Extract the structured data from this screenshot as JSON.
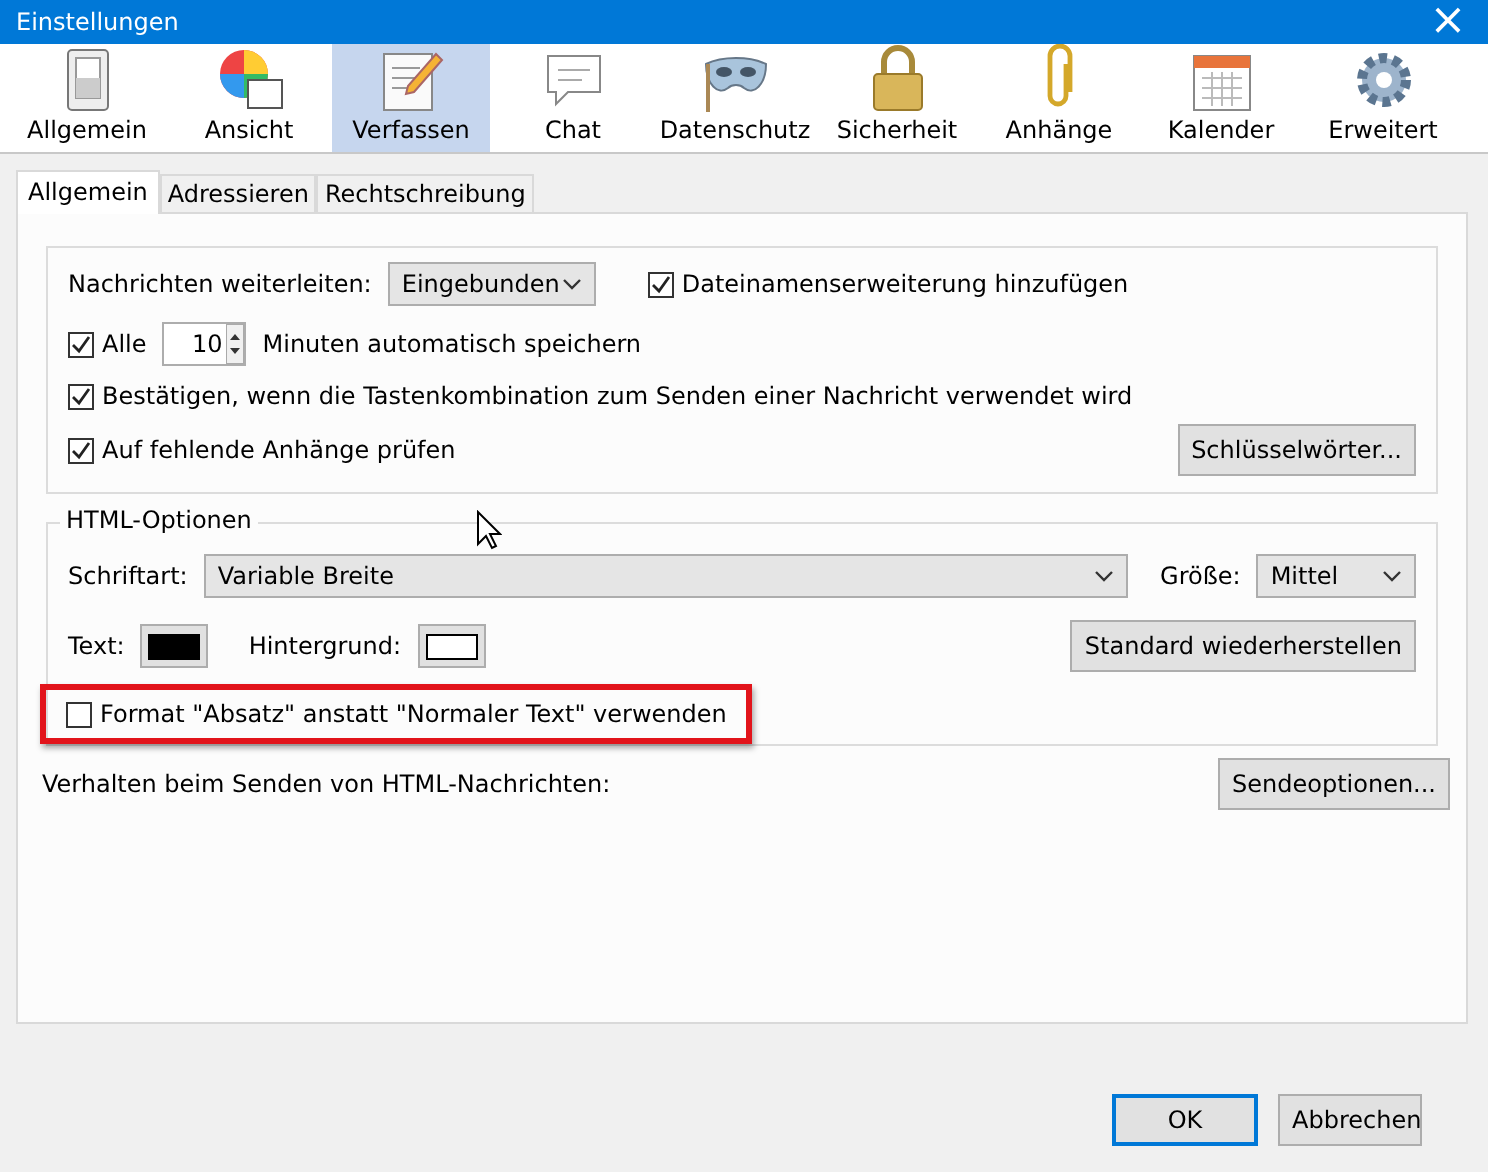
{
  "window": {
    "title": "Einstellungen",
    "close": "×"
  },
  "panes": [
    {
      "label": "Allgemein",
      "selected": false
    },
    {
      "label": "Ansicht",
      "selected": false
    },
    {
      "label": "Verfassen",
      "selected": true
    },
    {
      "label": "Chat",
      "selected": false
    },
    {
      "label": "Datenschutz",
      "selected": false
    },
    {
      "label": "Sicherheit",
      "selected": false
    },
    {
      "label": "Anhänge",
      "selected": false
    },
    {
      "label": "Kalender",
      "selected": false
    },
    {
      "label": "Erweitert",
      "selected": false
    }
  ],
  "tabs": [
    {
      "label": "Allgemein",
      "selected": true
    },
    {
      "label": "Adressieren",
      "selected": false
    },
    {
      "label": "Rechtschreibung",
      "selected": false
    }
  ],
  "general": {
    "forward_label": "Nachrichten weiterleiten:",
    "forward_value": "Eingebunden",
    "extension": {
      "label": "Dateinamenserweiterung hinzufügen",
      "checked": true
    },
    "autosave": {
      "label": "Alle",
      "checked": true,
      "value": "10",
      "suffix": "Minuten automatisch speichern"
    },
    "confirm": {
      "label": "Bestätigen, wenn die Tastenkombination zum Senden einer Nachricht verwendet wird",
      "checked": true
    },
    "attachments": {
      "label": "Auf fehlende Anhänge prüfen",
      "checked": true
    },
    "keywords_button": "Schlüsselwörter..."
  },
  "html_options": {
    "title": "HTML-Optionen",
    "font_label": "Schriftart:",
    "font_value": "Variable Breite",
    "size_label": "Größe:",
    "size_value": "Mittel",
    "swatches": [
      {
        "label": "Text:",
        "color": "#000000"
      },
      {
        "label": "Hintergrund:",
        "color": "#ffffff"
      }
    ],
    "reset_button": "Standard wiederherstellen",
    "paragraph": {
      "label": "Format \"Absatz\" anstatt \"Normaler Text\" verwenden",
      "checked": false,
      "highlighted": true
    }
  },
  "send_label": "Verhalten beim Senden von HTML-Nachrichten:",
  "send_button": "Sendeoptionen...",
  "buttons": [
    "OK",
    "Abbrechen"
  ]
}
